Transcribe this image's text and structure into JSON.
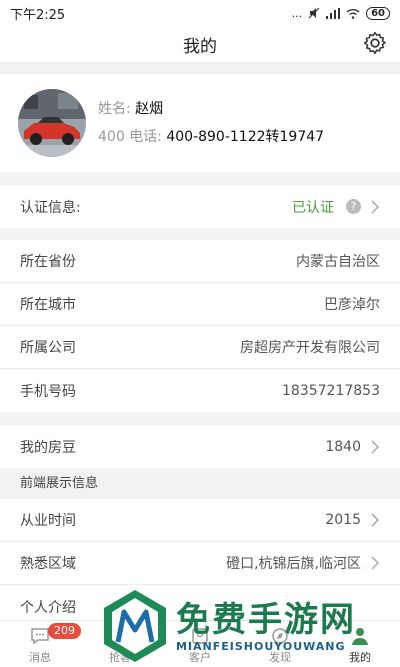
{
  "statusbar": {
    "time": "下午2:25",
    "signal": "...",
    "battery": "60"
  },
  "header": {
    "title": "我的"
  },
  "profile": {
    "name_label": "姓名:",
    "name_value": "赵烟",
    "phone_label": "400 电话:",
    "phone_value": "400-890-1122转19747"
  },
  "verification": {
    "label": "认证信息:",
    "status": "已认证",
    "help": "?"
  },
  "details": [
    {
      "label": "所在省份",
      "value": "内蒙古自治区"
    },
    {
      "label": "所在城市",
      "value": "巴彦淖尔"
    },
    {
      "label": "所属公司",
      "value": "房超房产开发有限公司"
    },
    {
      "label": "手机号码",
      "value": "18357217853"
    }
  ],
  "beans": {
    "label": "我的房豆",
    "value": "1840"
  },
  "frontend": {
    "header": "前端展示信息",
    "rows": [
      {
        "label": "从业时间",
        "value": "2015"
      },
      {
        "label": "熟悉区域",
        "value": "磴口,杭锦后旗,临河区"
      },
      {
        "label": "个人介绍",
        "value": ""
      }
    ]
  },
  "tabs": [
    {
      "label": "消息",
      "icon": "chat-icon",
      "badge": "209"
    },
    {
      "label": "抢客",
      "icon": "grab-icon"
    },
    {
      "label": "客户",
      "icon": "customer-icon"
    },
    {
      "label": "发现",
      "icon": "discover-icon"
    },
    {
      "label": "我的",
      "icon": "person-icon"
    }
  ],
  "watermark": {
    "title": "免费手游网",
    "subtitle": "MIANFEISHOUYOUWANG"
  },
  "colors": {
    "verified": "#4a9d38",
    "badge": "#e84c3d",
    "background": "#f2f2f2"
  }
}
